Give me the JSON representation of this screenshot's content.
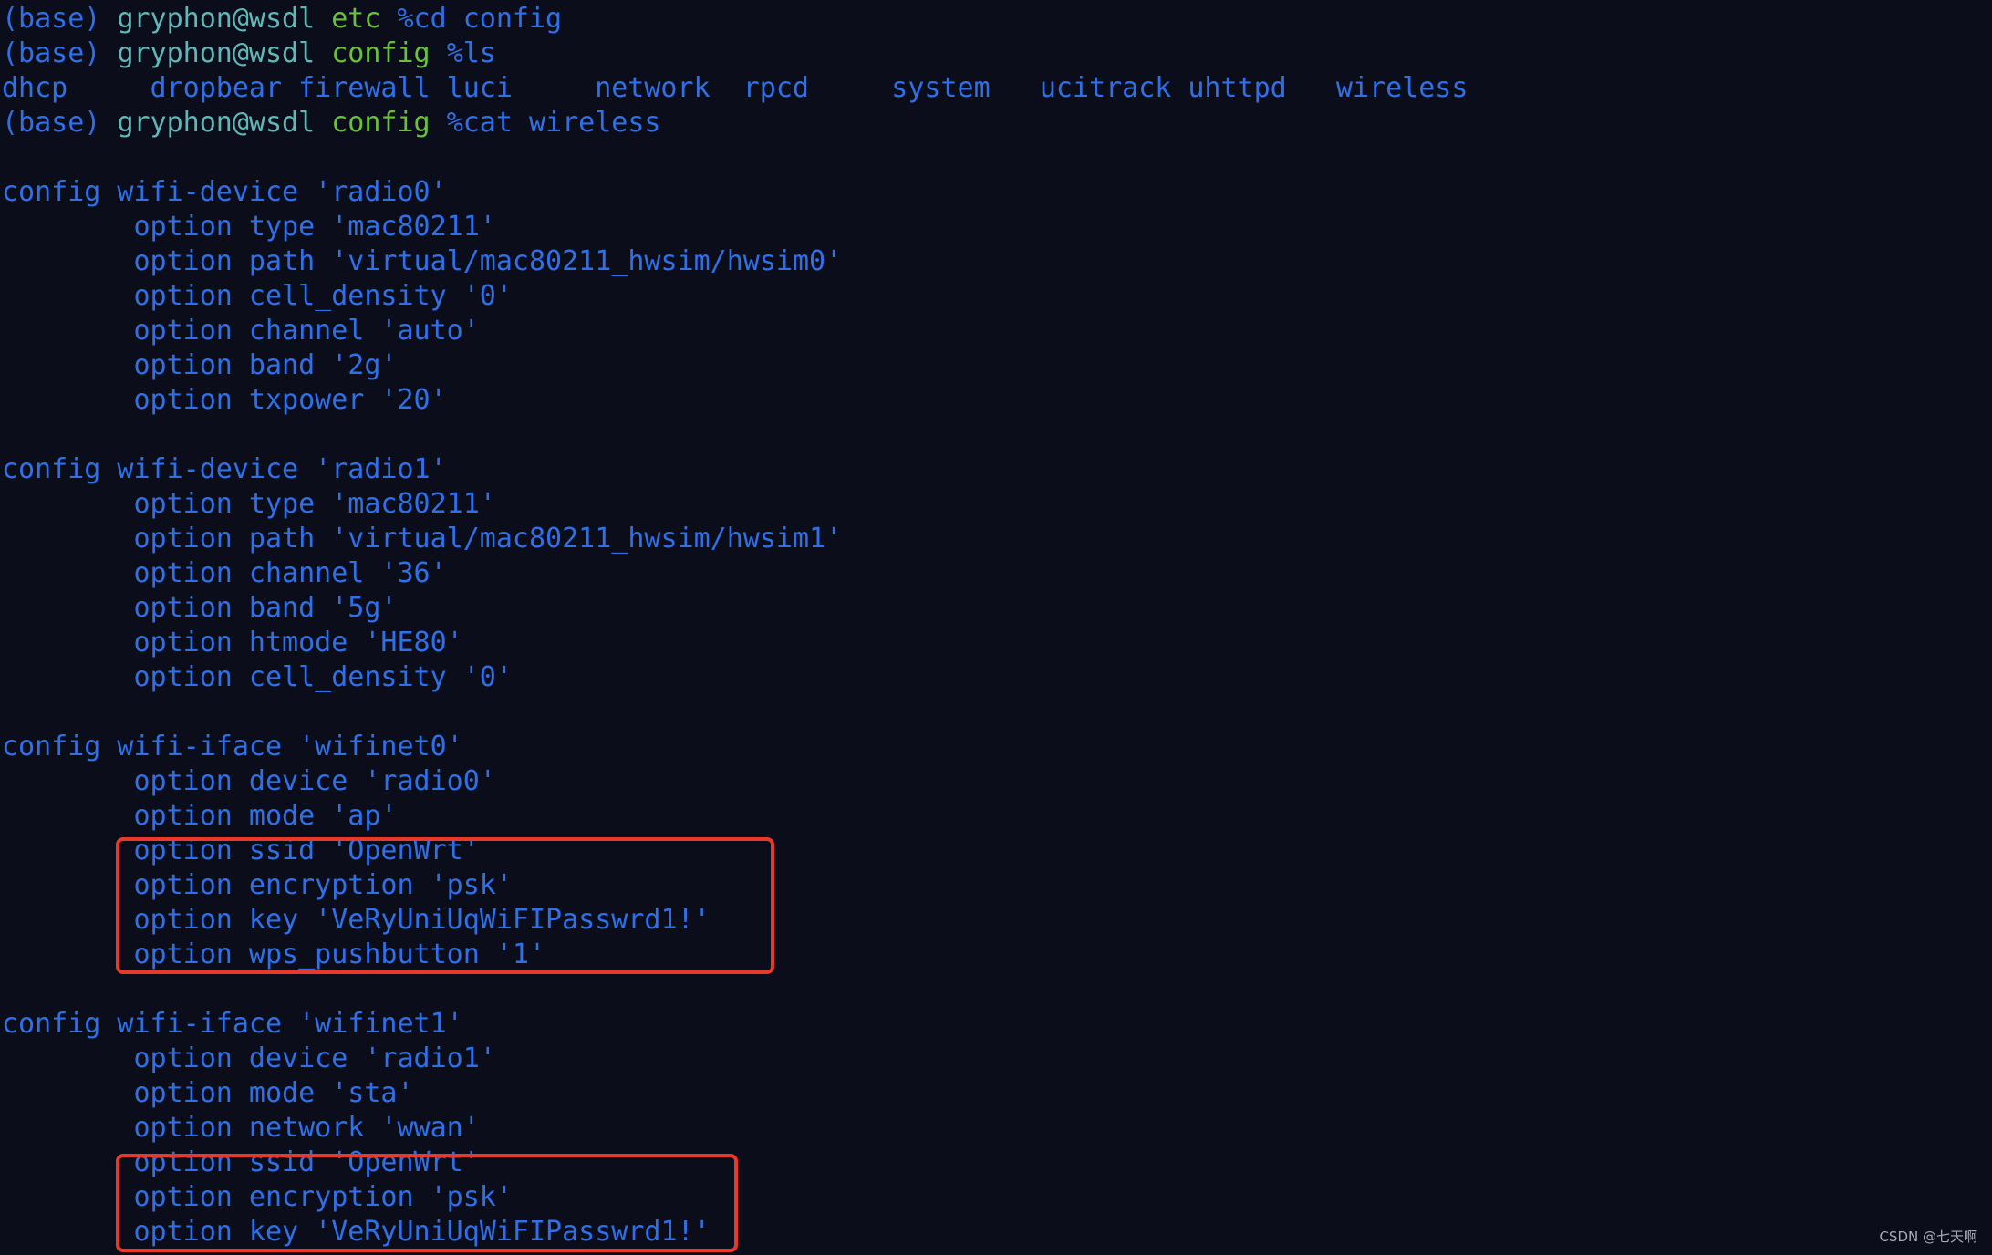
{
  "colors": {
    "background": "#0b0e1a",
    "text": "#2f6fe8",
    "user": "#5fb8b8",
    "dir": "#68c03c",
    "highlight_box": "#e8392a"
  },
  "prompts": [
    {
      "env": "(base)",
      "user": "gryphon@wsdl",
      "dir": "etc",
      "cmd": "%cd config"
    },
    {
      "env": "(base)",
      "user": "gryphon@wsdl",
      "dir": "config",
      "cmd": "%ls"
    },
    {
      "env": "(base)",
      "user": "gryphon@wsdl",
      "dir": "config",
      "cmd": "%cat wireless"
    }
  ],
  "ls_output": [
    "dhcp",
    "dropbear",
    "firewall",
    "luci",
    "network",
    "rpcd",
    "system",
    "ucitrack",
    "uhttpd",
    "wireless"
  ],
  "file_lines": [
    "",
    "config wifi-device 'radio0'",
    "\toption type 'mac80211'",
    "\toption path 'virtual/mac80211_hwsim/hwsim0'",
    "\toption cell_density '0'",
    "\toption channel 'auto'",
    "\toption band '2g'",
    "\toption txpower '20'",
    "",
    "config wifi-device 'radio1'",
    "\toption type 'mac80211'",
    "\toption path 'virtual/mac80211_hwsim/hwsim1'",
    "\toption channel '36'",
    "\toption band '5g'",
    "\toption htmode 'HE80'",
    "\toption cell_density '0'",
    "",
    "config wifi-iface 'wifinet0'",
    "\toption device 'radio0'",
    "\toption mode 'ap'",
    "\toption ssid 'OpenWrt'",
    "\toption encryption 'psk'",
    "\toption key 'VeRyUniUqWiFIPasswrd1!'",
    "\toption wps_pushbutton '1'",
    "",
    "config wifi-iface 'wifinet1'",
    "\toption device 'radio1'",
    "\toption mode 'sta'",
    "\toption network 'wwan'",
    "\toption ssid 'OpenWrt'",
    "\toption encryption 'psk'",
    "\toption key 'VeRyUniUqWiFIPasswrd1!'"
  ],
  "watermark": "CSDN @七天啊"
}
